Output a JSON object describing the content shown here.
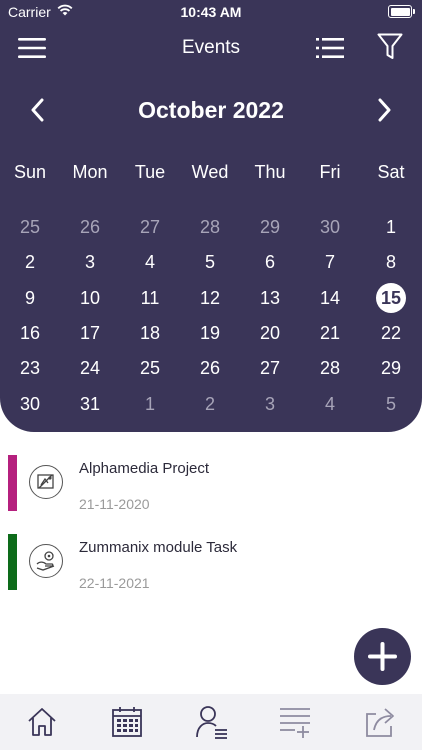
{
  "status": {
    "carrier": "Carrier",
    "time": "10:43 AM"
  },
  "header": {
    "title": "Events"
  },
  "calendar": {
    "month_label": "October 2022",
    "weekdays": [
      "Sun",
      "Mon",
      "Tue",
      "Wed",
      "Thu",
      "Fri",
      "Sat"
    ],
    "weeks": [
      [
        "25",
        "26",
        "27",
        "28",
        "29",
        "30",
        "1"
      ],
      [
        "2",
        "3",
        "4",
        "5",
        "6",
        "7",
        "8"
      ],
      [
        "9",
        "10",
        "11",
        "12",
        "13",
        "14",
        "15"
      ],
      [
        "16",
        "17",
        "18",
        "19",
        "20",
        "21",
        "22"
      ],
      [
        "23",
        "24",
        "25",
        "26",
        "27",
        "28",
        "29"
      ],
      [
        "30",
        "31",
        "1",
        "2",
        "3",
        "4",
        "5"
      ]
    ],
    "selected_day": "15"
  },
  "events": [
    {
      "title": "Alphamedia Project",
      "date": "21-11-2020",
      "color": "#b5207e",
      "icon": "design-icon"
    },
    {
      "title": "Zummanix module Task",
      "date": "22-11-2021",
      "color": "#0d6b1a",
      "icon": "task-settings-icon"
    }
  ],
  "tabs": [
    "home-icon",
    "calendar-icon",
    "user-list-icon",
    "add-list-icon",
    "share-icon"
  ],
  "colors": {
    "primary": "#3a3558",
    "muted_day": "#a7a4b8",
    "tab_bar": "#f2f2f5"
  }
}
